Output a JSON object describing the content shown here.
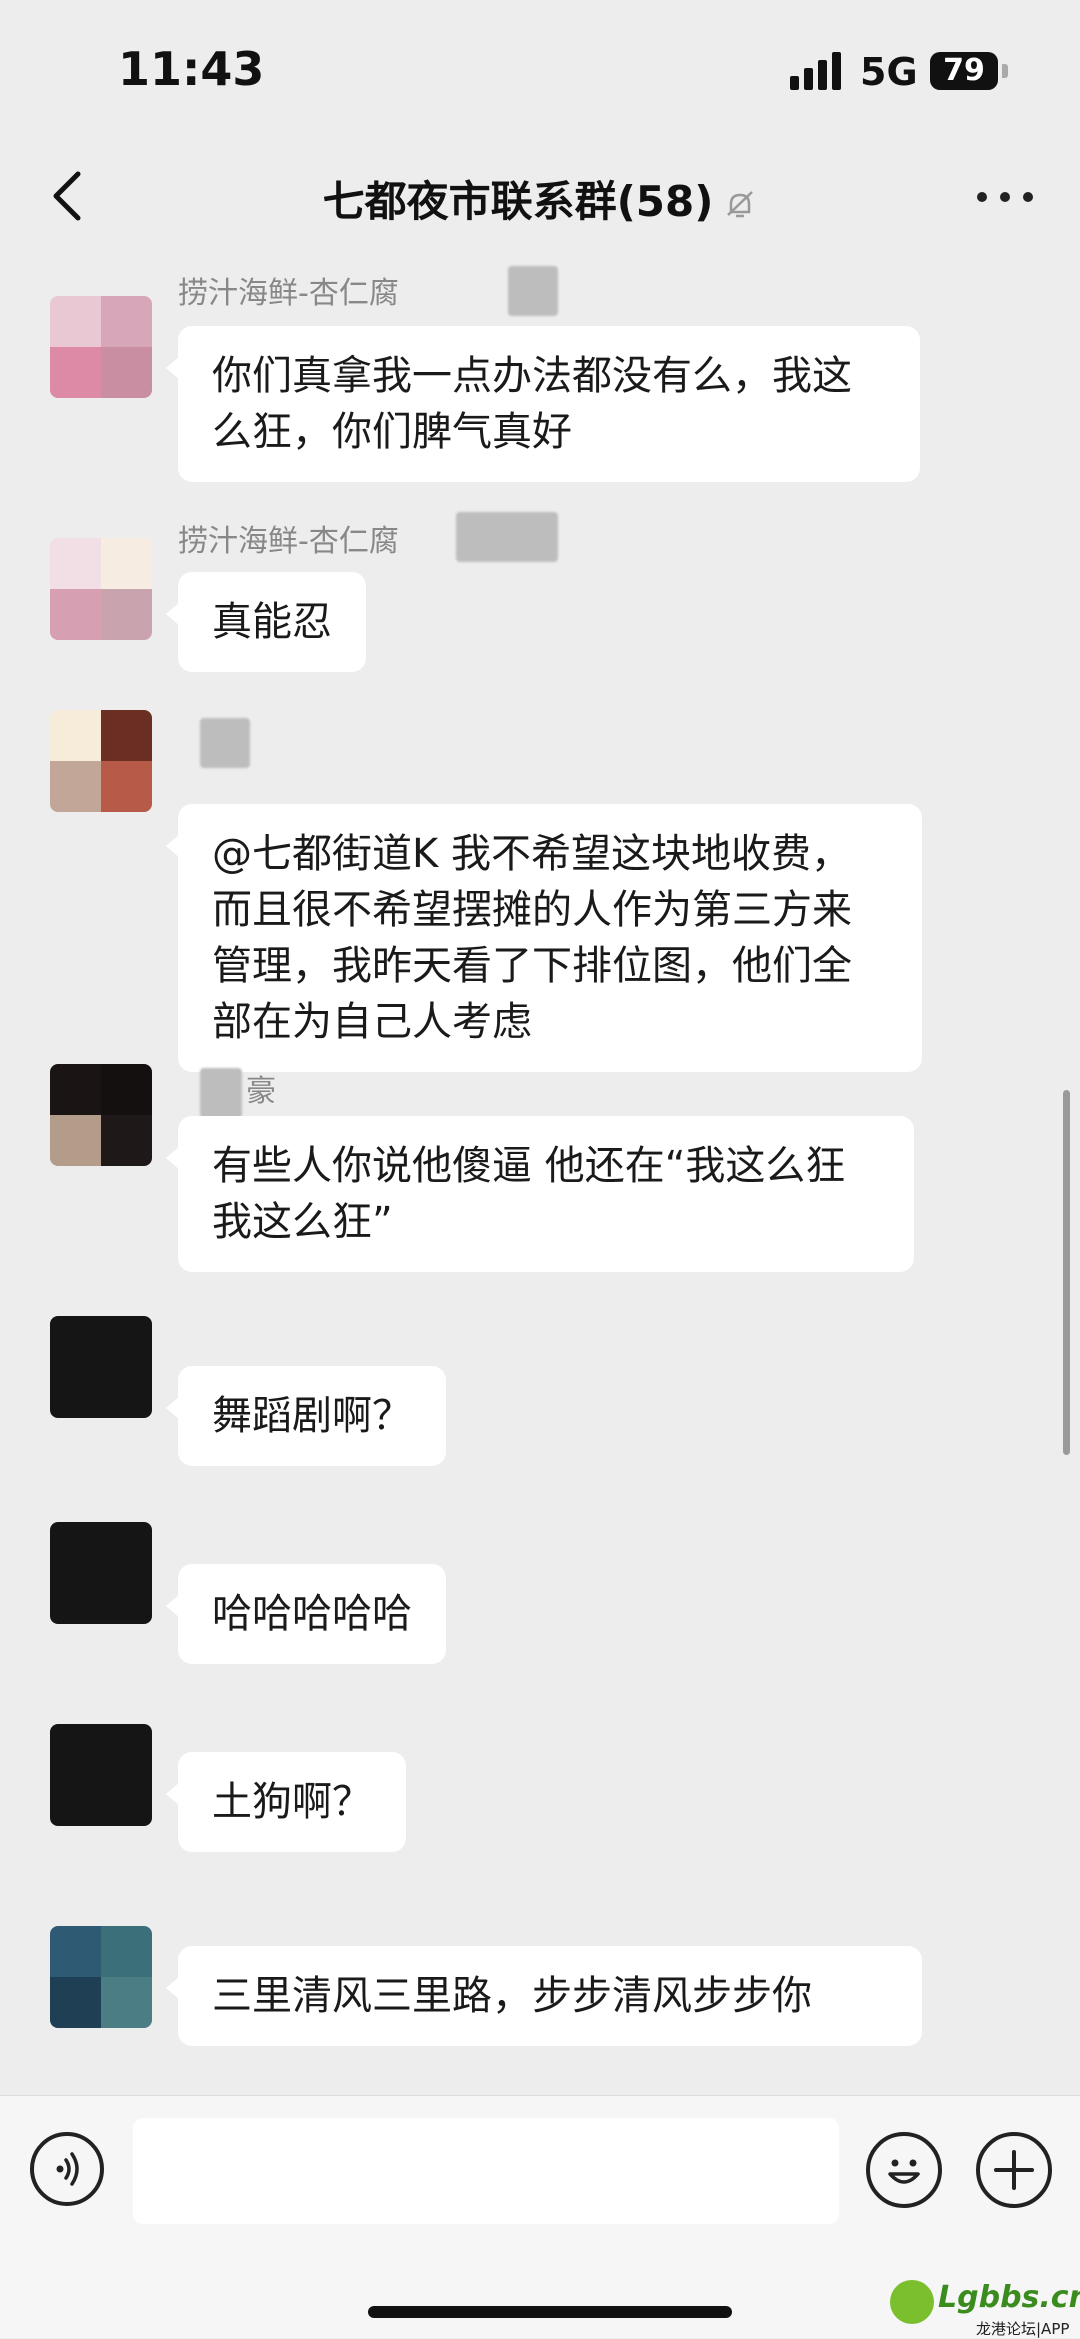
{
  "status_bar": {
    "time": "11:43",
    "network": "5G",
    "battery": "79"
  },
  "nav": {
    "title": "七都夜市联系群(58)",
    "back_icon": "chevron-left-icon",
    "more_icon": "more-icon",
    "mute_icon": "bell-muted-icon"
  },
  "messages": [
    {
      "sender": "捞汁海鲜-杏仁腐",
      "text": "你们真拿我一点办法都没有么，我这么狂，你们脾气真好"
    },
    {
      "sender": "捞汁海鲜-杏仁腐",
      "text": "真能忍"
    },
    {
      "sender": "",
      "text": "@七都街道K 我不希望这块地收费，而且很不希望摆摊的人作为第三方来管理，我昨天看了下排位图，他们全部在为自己人考虑"
    },
    {
      "sender": "豪",
      "text": "有些人你说他傻逼 他还在“我这么狂 我这么狂”"
    },
    {
      "sender": "",
      "text": "舞蹈剧啊？"
    },
    {
      "sender": "",
      "text": "哈哈哈哈哈"
    },
    {
      "sender": "",
      "text": "土狗啊？"
    },
    {
      "sender": "",
      "text": "三里清风三里路，步步清风步步你"
    }
  ],
  "input_bar": {
    "placeholder": "",
    "voice_icon": "voice-icon",
    "emoji_icon": "emoji-icon",
    "plus_icon": "plus-icon"
  },
  "watermark": {
    "brand": "Lgbbs.cn",
    "subtitle": "龙港论坛|APP"
  },
  "colors": {
    "background": "#ededed",
    "bubble": "#ffffff",
    "watermark_green": "#3a8c1e"
  }
}
